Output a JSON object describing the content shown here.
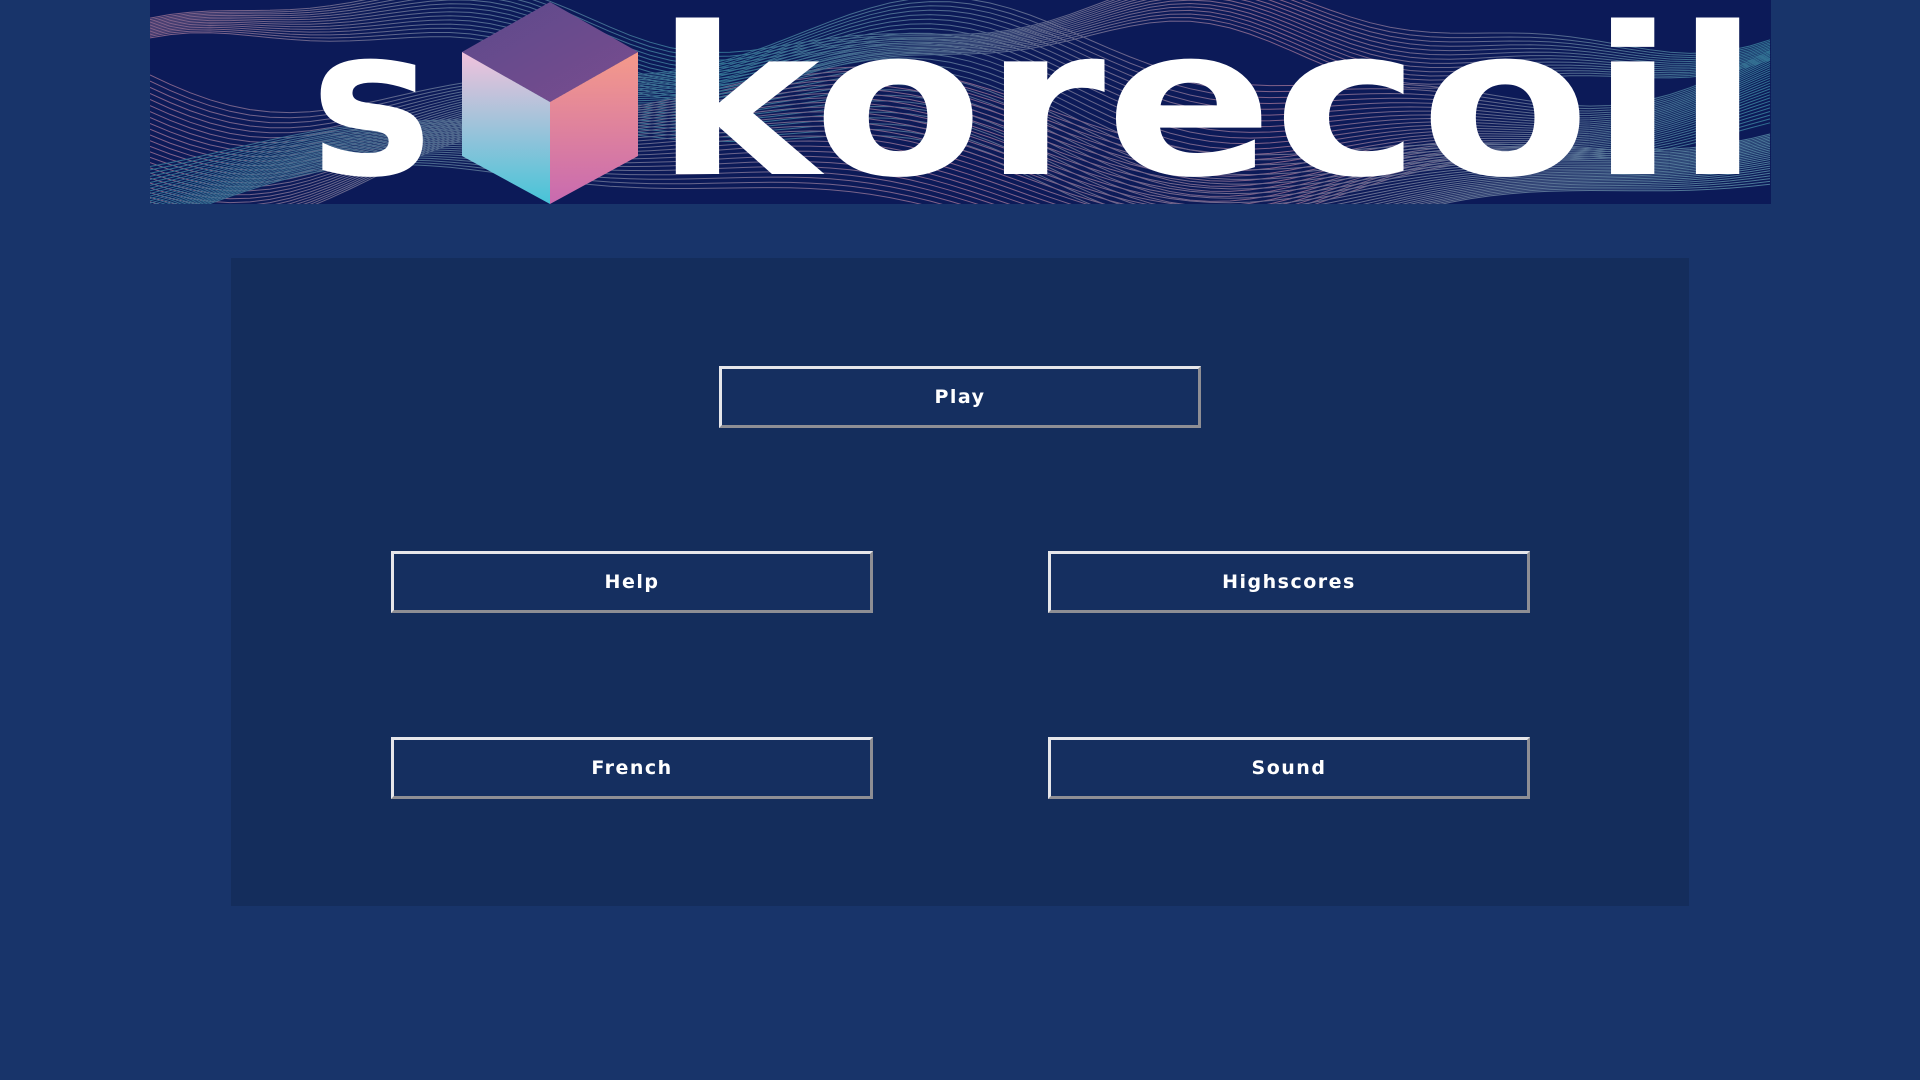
{
  "logo": {
    "text_before_cube": "s",
    "text_after_cube": "korecoil",
    "cube": "cube-logo-icon",
    "colors": {
      "banner_bg": "#0c1a58",
      "wave_teal": "#4fb8c4",
      "wave_pink": "#e39ab0",
      "cube_top": "#6a4a90",
      "cube_left_top": "#f2c2dc",
      "cube_left_bottom": "#46c4d8",
      "cube_right_top": "#f59a8a",
      "cube_right_bottom": "#c86ab0"
    }
  },
  "menu": {
    "play": "Play",
    "help": "Help",
    "highscores": "Highscores",
    "language": "French",
    "sound": "Sound"
  },
  "theme": {
    "page_bg": "#18346a",
    "panel_bg": "#142d5c",
    "button_text": "#ffffff",
    "button_border_light": "#e6e6ea",
    "button_border_dark": "#8e8e94"
  }
}
